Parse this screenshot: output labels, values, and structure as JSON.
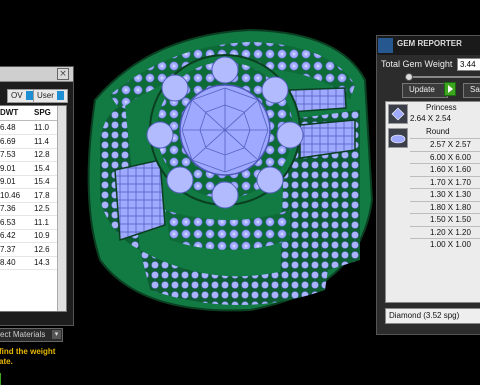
{
  "colors": {
    "metal": "#127a43",
    "gem": "#9ea9ff",
    "panel": "#2c2c2c",
    "accent": "#1e8fd3"
  },
  "left_panel": {
    "close_label": "×",
    "tabs": [
      {
        "label": "OV"
      },
      {
        "label": "User"
      }
    ],
    "columns": [
      "DWT",
      "SPG"
    ],
    "rows": [
      {
        "dwt": "6.48",
        "spg": "11.0"
      },
      {
        "dwt": "6.69",
        "spg": "11.4"
      },
      {
        "dwt": "7.53",
        "spg": "12.8"
      },
      {
        "dwt": "9.01",
        "spg": "15.4"
      },
      {
        "dwt": "9.01",
        "spg": "15.4"
      },
      {
        "dwt": "10.46",
        "spg": "17.8"
      },
      {
        "dwt": "7.36",
        "spg": "12.5"
      },
      {
        "dwt": "6.53",
        "spg": "11.1"
      },
      {
        "dwt": "6.42",
        "spg": "10.9"
      },
      {
        "dwt": "7.37",
        "spg": "12.6"
      },
      {
        "dwt": "8.40",
        "spg": "14.3"
      }
    ],
    "materials_label": "ect Materials",
    "hint_line1": "find the weight",
    "hint_line2": "ate."
  },
  "gem_reporter": {
    "logo_text": "",
    "title": "GEM REPORTER",
    "total_label": "Total Gem Weight",
    "total_value": "3.44",
    "update_label": "Update",
    "save_label": "Sa",
    "shapes": [
      {
        "name": "Princess",
        "sizes": [
          "2.64 X 2.54"
        ]
      },
      {
        "name": "Round",
        "sizes": [
          "2.57 X 2.57",
          "6.00 X 6.00",
          "1.60 X 1.60",
          "1.70 X 1.70",
          "1.30 X 1.30",
          "1.80 X 1.80",
          "1.50 X 1.50",
          "1.20 X 1.20",
          "1.00 X 1.00"
        ]
      }
    ],
    "material": "Diamond     (3.52 spg)"
  }
}
